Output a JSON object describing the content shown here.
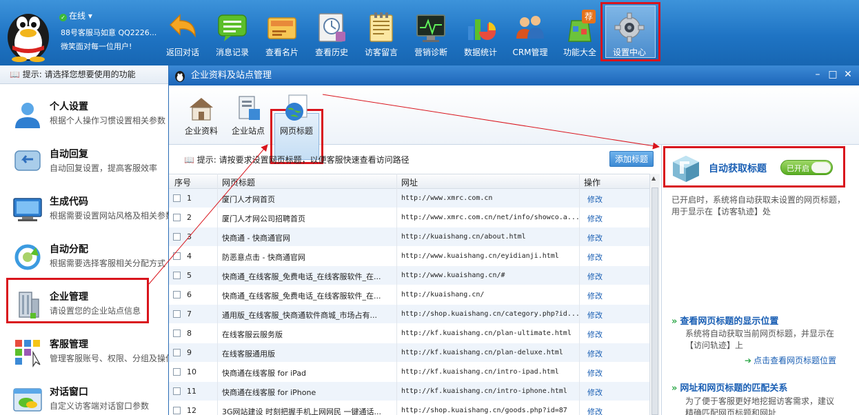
{
  "topbar": {
    "status": "在线",
    "username": "88号客服马如意 QQ2226...",
    "motto": "微笑面对每一位用户!",
    "tools": [
      {
        "label": "返回对话",
        "icon": "back-arrow-icon"
      },
      {
        "label": "消息记录",
        "icon": "message-icon"
      },
      {
        "label": "查看名片",
        "icon": "business-card-icon"
      },
      {
        "label": "查看历史",
        "icon": "history-icon"
      },
      {
        "label": "访客留言",
        "icon": "notepad-icon"
      },
      {
        "label": "营销诊断",
        "icon": "diagnosis-icon"
      },
      {
        "label": "数据统计",
        "icon": "chart-icon"
      },
      {
        "label": "CRM管理",
        "icon": "crm-people-icon"
      },
      {
        "label": "功能大全",
        "icon": "feature-icon"
      },
      {
        "label": "设置中心",
        "icon": "gear-icon"
      }
    ],
    "badge": "荐"
  },
  "leftpanel": {
    "hint": "提示: 请选择您想要使用的功能",
    "items": [
      {
        "title": "个人设置",
        "desc": "根据个人操作习惯设置相关参数"
      },
      {
        "title": "自动回复",
        "desc": "自动回复设置，提高客服效率"
      },
      {
        "title": "生成代码",
        "desc": "根据需要设置网站风格及相关参数"
      },
      {
        "title": "自动分配",
        "desc": "根据需要选择客服相关分配方式"
      },
      {
        "title": "企业管理",
        "desc": "请设置您的企业站点信息"
      },
      {
        "title": "客服管理",
        "desc": "管理客服账号、权限、分组及操作"
      },
      {
        "title": "对话窗口",
        "desc": "自定义访客端对话窗口参数"
      }
    ]
  },
  "dialog": {
    "title": "企业资料及站点管理",
    "toolbar": [
      "企业资料",
      "企业站点",
      "网页标题"
    ],
    "tip": "提示: 请按要求设置网页标题，以便客服快速查看访问路径",
    "add_button": "添加标题",
    "table": {
      "headers": [
        "序号",
        "网页标题",
        "网址",
        "操作"
      ],
      "rows": [
        {
          "no": "1",
          "title": "厦门人才网首页",
          "url": "http://www.xmrc.com.cn",
          "op": "修改"
        },
        {
          "no": "2",
          "title": "厦门人才网公司招聘首页",
          "url": "http://www.xmrc.com.cn/net/info/showco.a...",
          "op": "修改"
        },
        {
          "no": "3",
          "title": "快商通 - 快商通官网",
          "url": "http://kuaishang.cn/about.html",
          "op": "修改"
        },
        {
          "no": "4",
          "title": "防恶意点击 - 快商通官网",
          "url": "http://www.kuaishang.cn/eyidianji.html",
          "op": "修改"
        },
        {
          "no": "5",
          "title": "快商通_在线客服_免费电话_在线客服软件_在...",
          "url": "http://www.kuaishang.cn/#",
          "op": "修改"
        },
        {
          "no": "6",
          "title": "快商通_在线客服_免费电话_在线客服软件_在...",
          "url": "http://kuaishang.cn/",
          "op": "修改"
        },
        {
          "no": "7",
          "title": "通用版_在线客服_快商通软件商城_市场占有...",
          "url": "http://shop.kuaishang.cn/category.php?id...",
          "op": "修改"
        },
        {
          "no": "8",
          "title": "在线客服云服务版",
          "url": "http://kf.kuaishang.cn/plan-ultimate.html",
          "op": "修改"
        },
        {
          "no": "9",
          "title": "在线客服通用版",
          "url": "http://kf.kuaishang.cn/plan-deluxe.html",
          "op": "修改"
        },
        {
          "no": "10",
          "title": "快商通在线客服 for iPad",
          "url": "http://kf.kuaishang.cn/intro-ipad.html",
          "op": "修改"
        },
        {
          "no": "11",
          "title": "快商通在线客服 for iPhone",
          "url": "http://kf.kuaishang.cn/intro-iphone.html",
          "op": "修改"
        },
        {
          "no": "12",
          "title": "3G网站建设 时刻把握手机上网网民 一键通话...",
          "url": "http://shop.kuaishang.cn/goods.php?id=87",
          "op": "修改"
        }
      ]
    },
    "right": {
      "auto_title": "自动获取标题",
      "toggle": "已开启",
      "auto_desc": "已开启时，系统将自动获取未设置的网页标题，用于显示在【访客轨迹】处",
      "sec1_title": "查看网页标题的显示位置",
      "sec1_desc": "系统将自动获取当前网页标题，并显示在【访问轨迹】上",
      "sec1_link": "点击查看网页标题位置",
      "sec2_title": "网址和网页标题的匹配关系",
      "sec2_desc": "为了便于客服更好地挖掘访客需求，建议精确匹配网页标题和网址"
    }
  }
}
